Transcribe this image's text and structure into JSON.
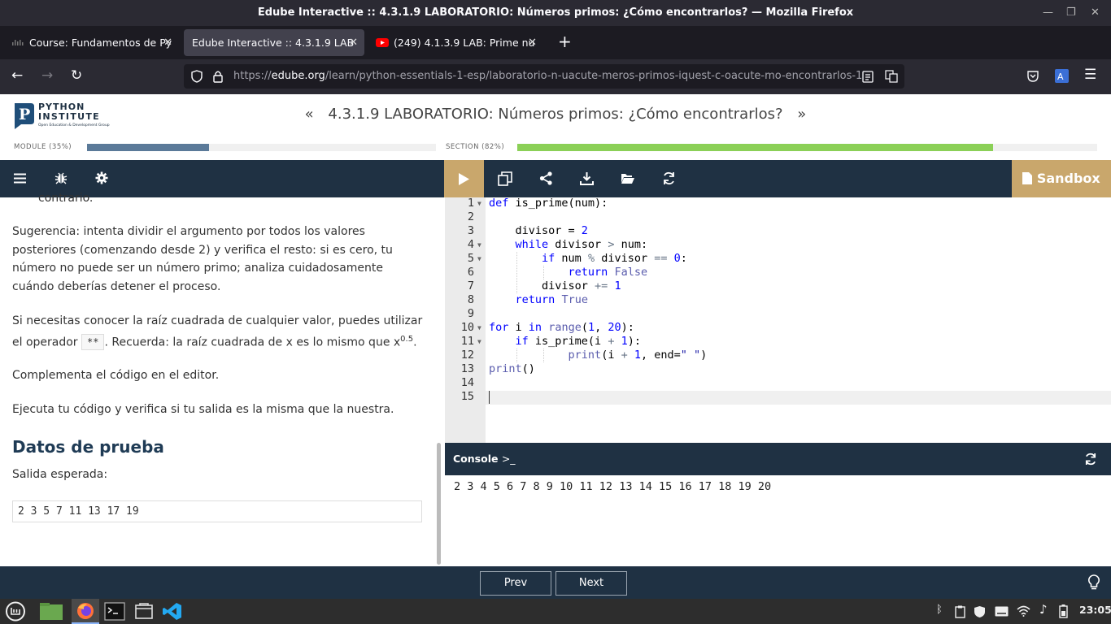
{
  "window": {
    "title": "Edube Interactive :: 4.3.1.9 LABORATORIO: Números primos: ¿Cómo encontrarlos? — Mozilla Firefox"
  },
  "tabs": [
    {
      "label": "Course: Fundamentos de Py",
      "icon": "cisco-icon",
      "active": false
    },
    {
      "label": "Edube Interactive :: 4.3.1.9 LAB",
      "icon": "none",
      "active": true
    },
    {
      "label": "(249) 4.1.3.9 LAB: Prime nu",
      "icon": "youtube-icon",
      "active": false
    }
  ],
  "urlbar": {
    "prefix": "https://",
    "domain": "edube.org",
    "path": "/learn/python-essentials-1-esp/laboratorio-n-uacute-meros-primos-iquest-c-oacute-mo-encontrarlos-1"
  },
  "logo": {
    "line1": "PYTHON",
    "line2": "INSTITUTE",
    "tagline": "Open Education & Development Group"
  },
  "lesson": {
    "title": "4.3.1.9 LABORATORIO: Números primos: ¿Cómo encontrarlos?",
    "prev_glyph": "«",
    "next_glyph": "»"
  },
  "progress": {
    "module_label": "MODULE (35%)",
    "module_fraction": 0.35,
    "section_label": "SECTION (82%)",
    "section_fraction": 0.82,
    "module_color": "#5b7a99",
    "section_color": "#8bd057"
  },
  "content": {
    "cut_line": "contrario.",
    "hint": "Sugerencia: intenta dividir el argumento por todos los valores posteriores (comenzando desde 2) y verifica el resto: si es cero, tu número no puede ser un número primo; analiza cuidadosamente cuándo deberías detener el proceso.",
    "sqrt_before": "Si necesitas conocer la raíz cuadrada de cualquier valor, puedes utilizar el operador",
    "sqrt_operator": "**",
    "sqrt_after": ". Recuerda: la raíz cuadrada de x es lo mismo que x",
    "sqrt_exponent": "0.5",
    "sqrt_end": ".",
    "complete": "Complementa el código en el editor.",
    "run": "Ejecuta tu código y verifica si tu salida es la misma que la nuestra.",
    "test_heading": "Datos de prueba",
    "expected_label": "Salida esperada:",
    "expected_output": "2 3 5 7 11 13 17 19"
  },
  "toolbar": {
    "sandbox_label": "Sandbox"
  },
  "editor": {
    "line_numbers": [
      "1",
      "2",
      "3",
      "4",
      "5",
      "6",
      "7",
      "8",
      "9",
      "10",
      "11",
      "12",
      "13",
      "14",
      "15"
    ],
    "code_lines": [
      "def is_prime(num):",
      "",
      "    divisor = 2",
      "    while divisor > num:",
      "        if num % divisor == 0:",
      "            return False",
      "        divisor += 1",
      "    return True",
      "",
      "for i in range(1, 20):",
      "    if is_prime(i + 1):",
      "            print(i + 1, end=\" \")",
      "print()",
      "",
      ""
    ]
  },
  "console": {
    "label": "Console",
    "prompt": ">_",
    "output": "2 3 4 5 6 7 8 9 10 11 12 13 14 15 16 17 18 19 20"
  },
  "nav": {
    "prev": "Prev",
    "next": "Next"
  },
  "taskbar": {
    "clock": "23:05"
  }
}
